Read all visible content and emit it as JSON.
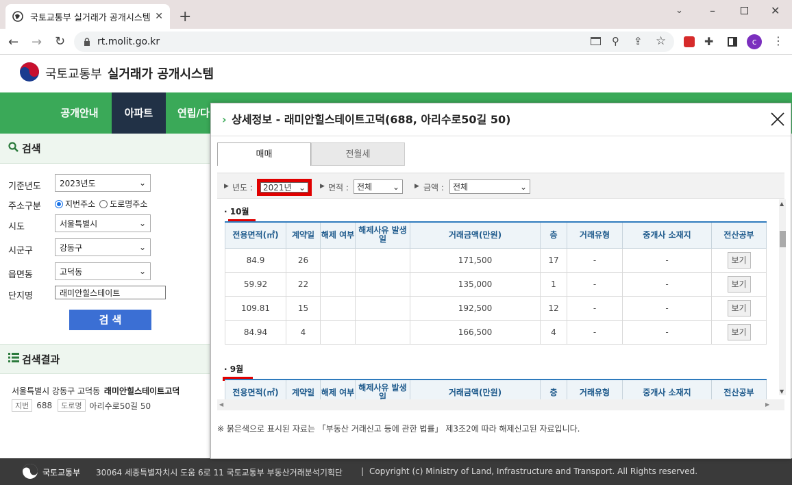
{
  "browser": {
    "tab_title": "국토교통부 실거래가 공개시스템",
    "new_tab": "+",
    "url": "rt.molit.go.kr",
    "profile_initial": "c"
  },
  "site": {
    "org_name": "국토교통부",
    "system_name": "실거래가 공개시스템",
    "nav": [
      "공개안내",
      "아파트",
      "연립/다"
    ],
    "active_nav": "아파트",
    "nav_active_color": "#213146",
    "brand_green": "#3aa958"
  },
  "search": {
    "heading": "검색",
    "fields": {
      "year_label": "기준년도",
      "year_value": "2023년도",
      "addr_type_label": "주소구분",
      "addr_jibun": "지번주소",
      "addr_road": "도로명주소",
      "sido_label": "시도",
      "sido_value": "서울특별시",
      "sigungu_label": "시군구",
      "sigungu_value": "강동구",
      "dong_label": "읍면동",
      "dong_value": "고덕동",
      "complex_label": "단지명",
      "complex_value": "래미안힐스테이트"
    },
    "button": "검 색"
  },
  "results": {
    "heading": "검색결과",
    "line1_addr": "서울특별시 강동구 고덕동",
    "line1_name": "래미안힐스테이트고덕",
    "jibun_tag": "지번",
    "jibun_value": "688",
    "road_tag": "도로명",
    "road_value": "아리수로50길 50"
  },
  "modal": {
    "title": "상세정보 - 래미안힐스테이트고덕(688, 아리수로50길 50)",
    "tabs": [
      "매매",
      "전월세"
    ],
    "active_tab": "매매",
    "filters": {
      "year_label": "년도 :",
      "year_value": "2021년",
      "area_label": "면적 :",
      "area_value": "전체",
      "price_label": "금액 :",
      "price_value": "전체"
    },
    "columns": [
      "전용면적(㎡)",
      "계약일",
      "해제 여부",
      "해제사유 발생일",
      "거래금액(만원)",
      "층",
      "거래유형",
      "중개사 소재지",
      "전산공부"
    ],
    "months": [
      {
        "label": "10월",
        "rows": [
          [
            "84.9",
            "26",
            "",
            "",
            "171,500",
            "17",
            "-",
            "-",
            "보기"
          ],
          [
            "59.92",
            "22",
            "",
            "",
            "135,000",
            "1",
            "-",
            "-",
            "보기"
          ],
          [
            "109.81",
            "15",
            "",
            "",
            "192,500",
            "12",
            "-",
            "-",
            "보기"
          ],
          [
            "84.94",
            "4",
            "",
            "",
            "166,500",
            "4",
            "-",
            "-",
            "보기"
          ]
        ]
      },
      {
        "label": "9월",
        "rows": []
      }
    ],
    "note": "※ 붉은색으로 표시된 자료는 「부동산 거래신고 등에 관한 법률」 제3조2에 따라 해제신고된 자료입니다."
  },
  "footer": {
    "org": "국토교통부",
    "address": "30064 세종특별자치시 도움 6로 11 국토교통부 부동산거래분석기획단",
    "separator": "|",
    "copyright": "Copyright (c) Ministry of Land, Infrastructure and Transport. All Rights reserved."
  }
}
